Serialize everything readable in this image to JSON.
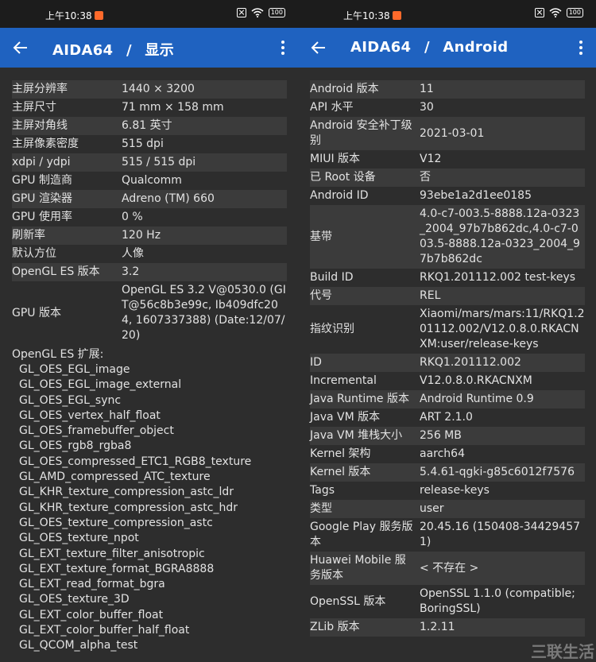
{
  "left": {
    "status": {
      "time": "上午10:38",
      "battery": "100"
    },
    "appbar": {
      "app": "AIDA64",
      "sep": "/",
      "page": "显示"
    },
    "rows": [
      {
        "label": "主屏分辨率",
        "value": "1440 × 3200"
      },
      {
        "label": "主屏尺寸",
        "value": "71 mm × 158 mm"
      },
      {
        "label": "主屏对角线",
        "value": "6.81 英寸"
      },
      {
        "label": "主屏像素密度",
        "value": "515 dpi"
      },
      {
        "label": "xdpi / ydpi",
        "value": "515 / 515 dpi"
      },
      {
        "label": "GPU 制造商",
        "value": "Qualcomm"
      },
      {
        "label": "GPU 渲染器",
        "value": "Adreno (TM) 660"
      },
      {
        "label": "GPU 使用率",
        "value": "0 %"
      },
      {
        "label": "刷新率",
        "value": "120 Hz"
      },
      {
        "label": "默认方位",
        "value": "人像"
      },
      {
        "label": "OpenGL ES 版本",
        "value": "3.2"
      },
      {
        "label": "GPU 版本",
        "value": "OpenGL ES 3.2 V@0530.0 (GIT@56c8b3e99c, Ib409dfc204, 1607337388) (Date:12/07/20)"
      }
    ],
    "ext_title": "OpenGL ES 扩展:",
    "extensions": [
      "GL_OES_EGL_image",
      "GL_OES_EGL_image_external",
      "GL_OES_EGL_sync",
      "GL_OES_vertex_half_float",
      "GL_OES_framebuffer_object",
      "GL_OES_rgb8_rgba8",
      "GL_OES_compressed_ETC1_RGB8_texture",
      "GL_AMD_compressed_ATC_texture",
      "GL_KHR_texture_compression_astc_ldr",
      "GL_KHR_texture_compression_astc_hdr",
      "GL_OES_texture_compression_astc",
      "GL_OES_texture_npot",
      "GL_EXT_texture_filter_anisotropic",
      "GL_EXT_texture_format_BGRA8888",
      "GL_EXT_read_format_bgra",
      "GL_OES_texture_3D",
      "GL_EXT_color_buffer_float",
      "GL_EXT_color_buffer_half_float",
      "GL_QCOM_alpha_test"
    ]
  },
  "right": {
    "status": {
      "time": "上午10:38",
      "battery": "100"
    },
    "appbar": {
      "app": "AIDA64",
      "sep": "/",
      "page": "Android"
    },
    "rows": [
      {
        "label": "Android 版本",
        "value": "11"
      },
      {
        "label": "API 水平",
        "value": "30"
      },
      {
        "label": "Android 安全补丁级别",
        "value": "2021-03-01"
      },
      {
        "label": "MIUI 版本",
        "value": "V12"
      },
      {
        "label": "已 Root 设备",
        "value": "否"
      },
      {
        "label": "Android ID",
        "value": "93ebe1a2d1ee0185"
      },
      {
        "label": "基带",
        "value": "4.0-c7-003.5-8888.12a-0323_2004_97b7b862dc,4.0-c7-003.5-8888.12a-0323_2004_97b7b862dc"
      },
      {
        "label": "Build ID",
        "value": "RKQ1.201112.002 test-keys"
      },
      {
        "label": "代号",
        "value": "REL"
      },
      {
        "label": "指纹识别",
        "value": "Xiaomi/mars/mars:11/RKQ1.201112.002/V12.0.8.0.RKACNXM:user/release-keys"
      },
      {
        "label": "ID",
        "value": "RKQ1.201112.002"
      },
      {
        "label": "Incremental",
        "value": "V12.0.8.0.RKACNXM"
      },
      {
        "label": "Java Runtime 版本",
        "value": "Android Runtime 0.9"
      },
      {
        "label": "Java VM 版本",
        "value": "ART 2.1.0"
      },
      {
        "label": "Java VM 堆栈大小",
        "value": "256 MB"
      },
      {
        "label": "Kernel 架构",
        "value": "aarch64"
      },
      {
        "label": "Kernel 版本",
        "value": "5.4.61-qgki-g85c6012f7576"
      },
      {
        "label": "Tags",
        "value": "release-keys"
      },
      {
        "label": "类型",
        "value": "user"
      },
      {
        "label": "Google Play 服务版本",
        "value": "20.45.16 (150408-344294571)"
      },
      {
        "label": "Huawei Mobile 服务版本",
        "value": "< 不存在 >"
      },
      {
        "label": "OpenSSL 版本",
        "value": "OpenSSL 1.1.0 (compatible; BoringSSL)"
      },
      {
        "label": "ZLib 版本",
        "value": "1.2.11"
      }
    ],
    "watermark": "三联生活"
  },
  "colors": {
    "appbar": "#1f62c0",
    "background": "#2d2d2d",
    "shade": "#3b3b3b",
    "statusbar": "#1c1c1c"
  }
}
